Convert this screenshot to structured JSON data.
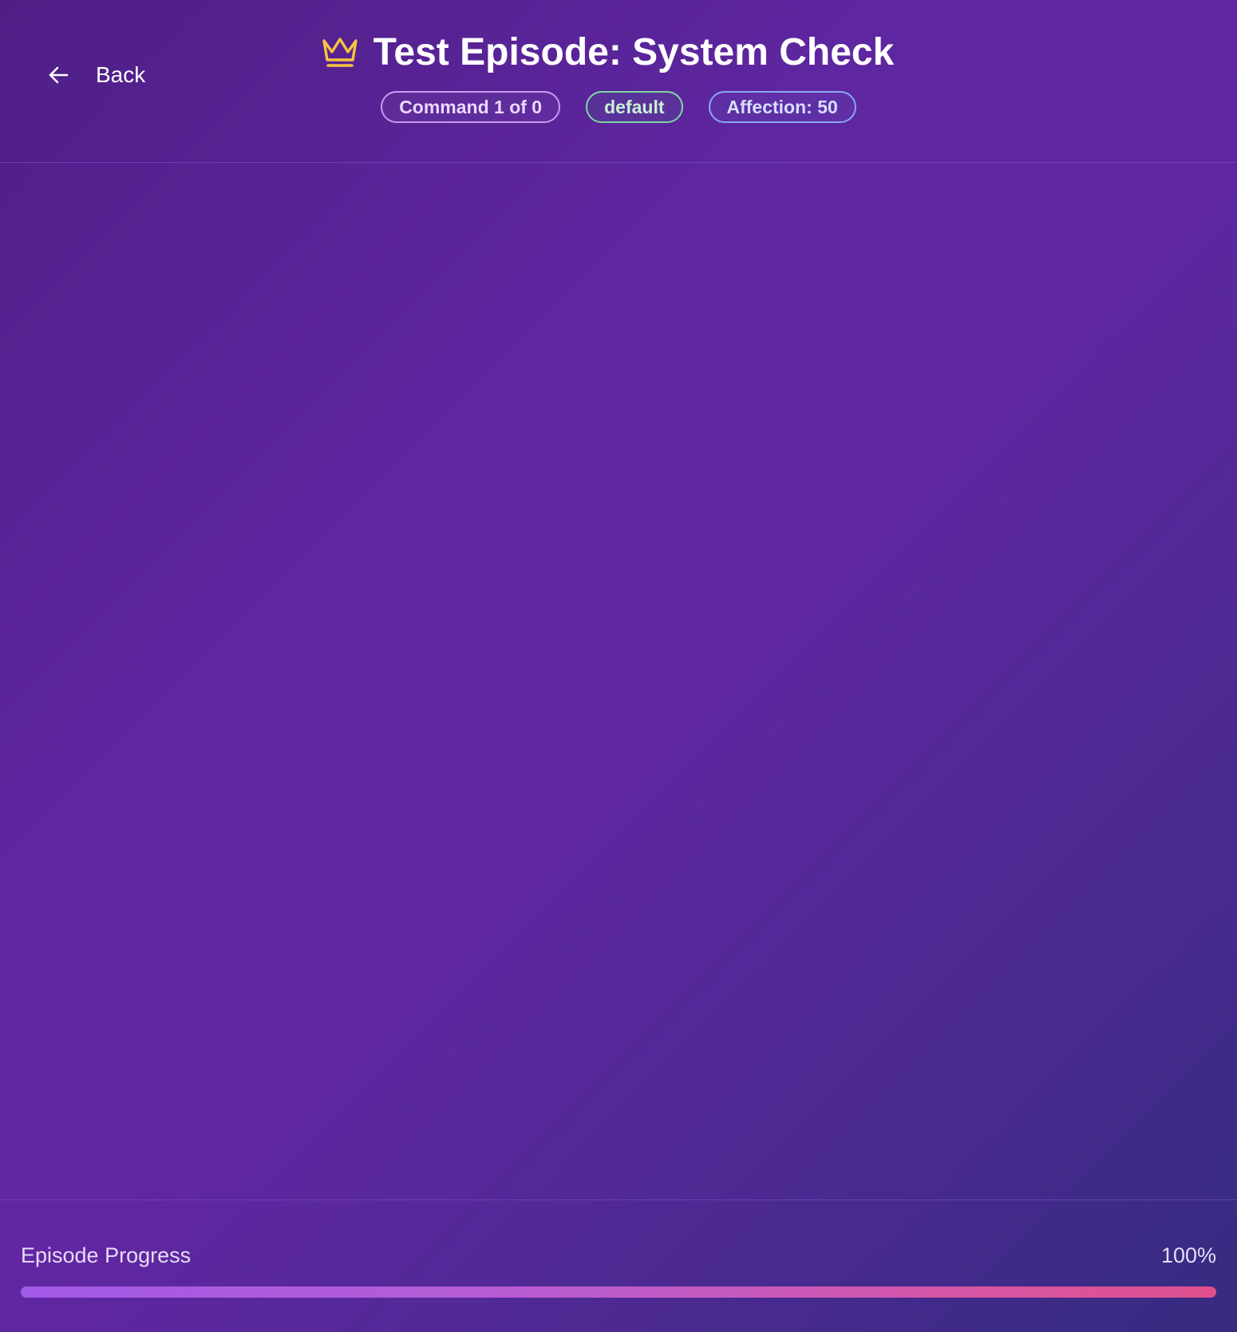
{
  "header": {
    "back_label": "Back",
    "title": "Test Episode: System Check",
    "badges": {
      "command": "Command 1 of 0",
      "mood": "default",
      "affection": "Affection: 50"
    }
  },
  "footer": {
    "progress_label": "Episode Progress",
    "progress_text": "100%",
    "progress_fraction": 1.0
  },
  "icons": {
    "back": "arrow-left-icon",
    "title": "crown-icon"
  },
  "colors": {
    "crown": "#f5c542",
    "progress_start": "#a25ae8",
    "progress_end": "#e0508e"
  }
}
